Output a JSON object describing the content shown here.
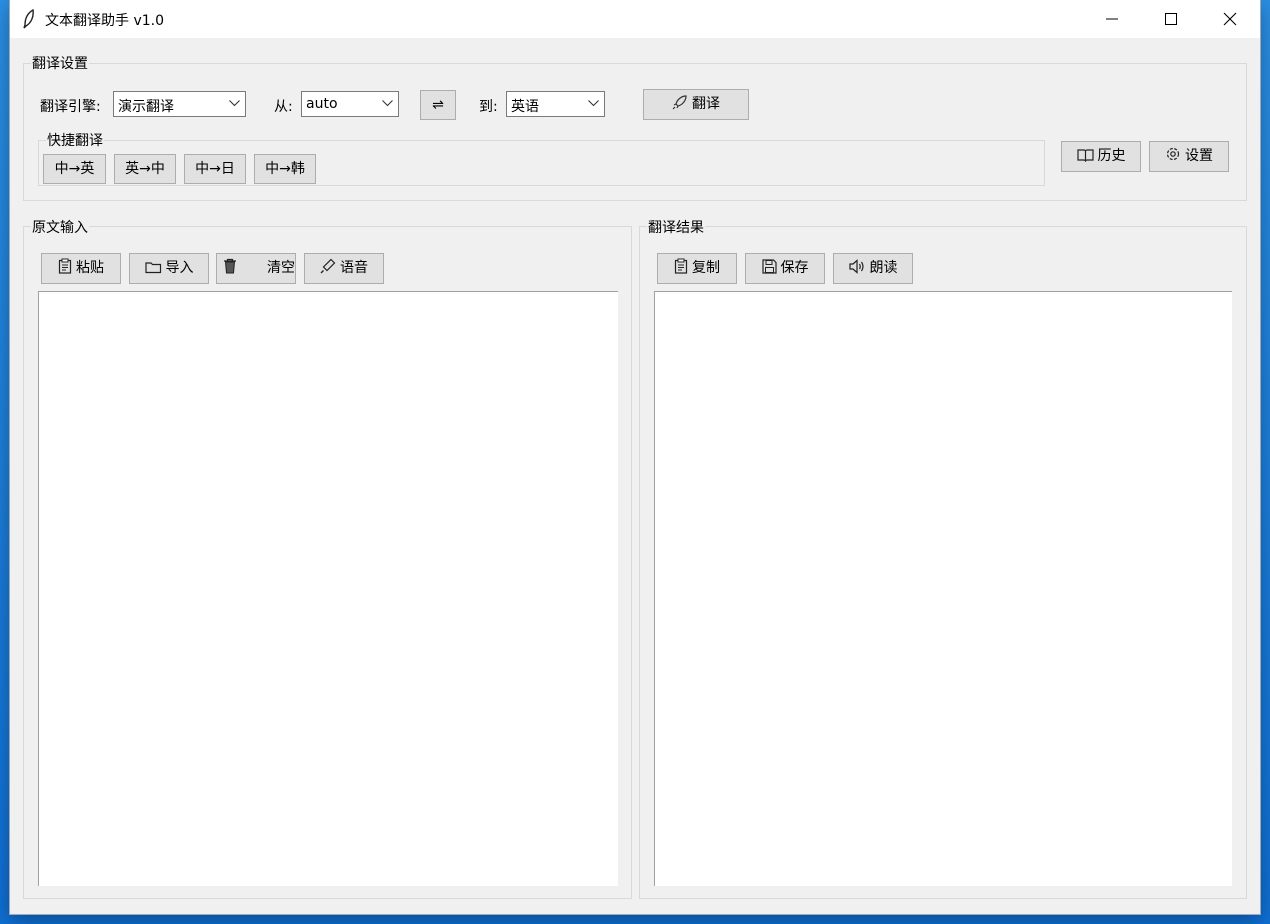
{
  "window": {
    "title": "文本翻译助手 v1.0"
  },
  "settings": {
    "legend": "翻译设置",
    "engine_label": "翻译引擎:",
    "engine_value": "演示翻译",
    "from_label": "从:",
    "from_value": "auto",
    "swap_label": "⇌",
    "to_label": "到:",
    "to_value": "英语",
    "translate_label": "翻译",
    "quick": {
      "legend": "快捷翻译",
      "buttons": [
        "中→英",
        "英→中",
        "中→日",
        "中→韩"
      ]
    },
    "history_label": "历史",
    "settings_label": "设置"
  },
  "source": {
    "legend": "原文输入",
    "paste_label": "粘贴",
    "import_label": "导入",
    "clear_label": "清空",
    "voice_label": "语音"
  },
  "result": {
    "legend": "翻译结果",
    "copy_label": "复制",
    "save_label": "保存",
    "read_label": "朗读"
  }
}
